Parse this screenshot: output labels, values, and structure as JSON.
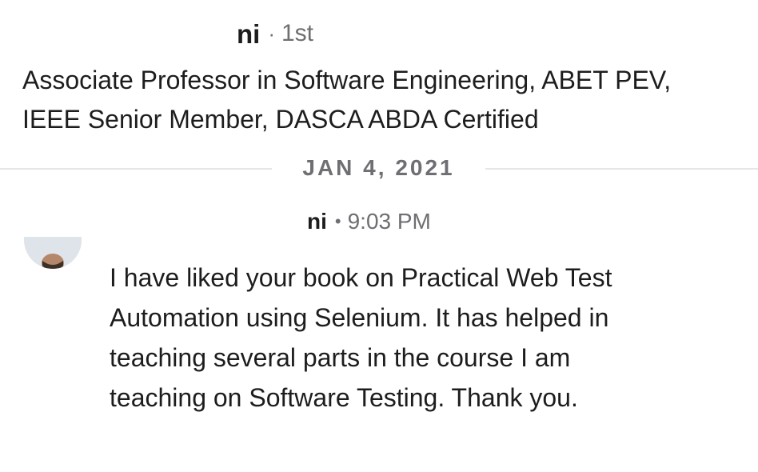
{
  "profile": {
    "name_fragment": "ni",
    "separator": "·",
    "connection_degree": "1st",
    "headline": "Associate Professor in Software Engineering, ABET PEV, IEEE Senior Member, DASCA ABDA Certified"
  },
  "conversation": {
    "date_divider": "JAN 4, 2021",
    "message": {
      "sender_fragment": "ni",
      "separator": "•",
      "timestamp": "9:03 PM",
      "body": "I have liked your book on Practical Web Test Automation using Selenium. It has helped in teaching several parts in the course I am teaching on Software Testing. Thank you."
    }
  },
  "colors": {
    "primary_text": "#1d1d1f",
    "secondary_text": "#6e6e73",
    "divider": "#e6e6e6",
    "background": "#ffffff"
  },
  "icons": {
    "avatar": "profile-photo"
  }
}
